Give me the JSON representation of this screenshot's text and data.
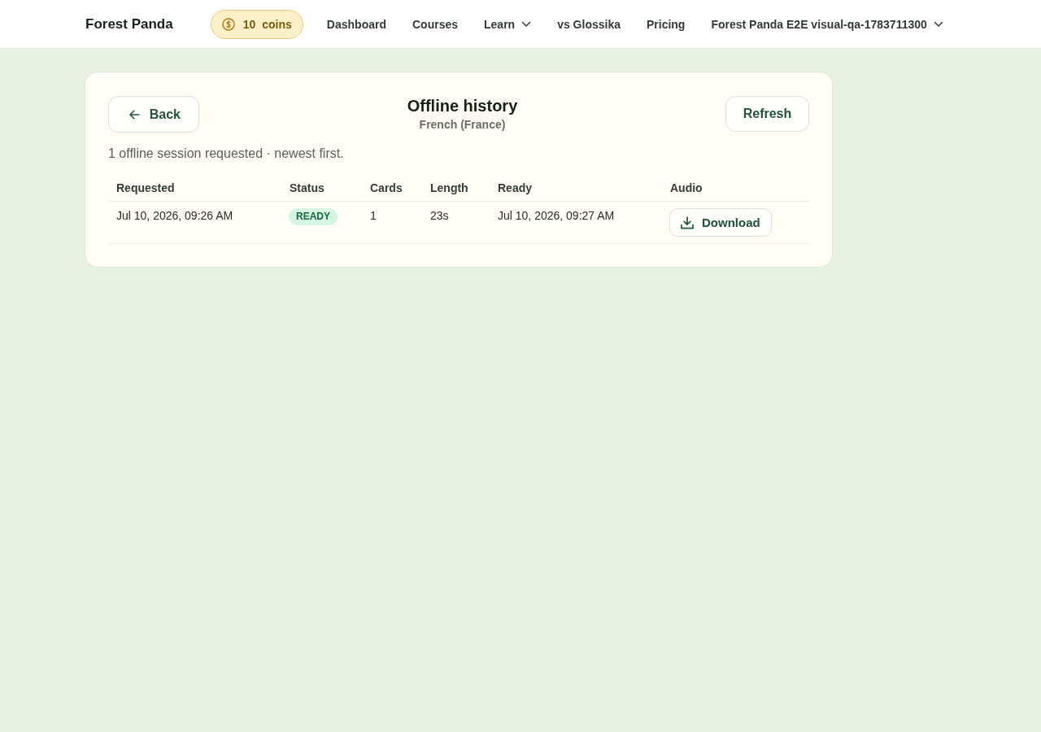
{
  "nav": {
    "brand": "Forest Panda",
    "coins": {
      "amount": "10",
      "label": "coins"
    },
    "links": [
      {
        "label": "Dashboard",
        "has_menu": false
      },
      {
        "label": "Courses",
        "has_menu": false
      },
      {
        "label": "Learn",
        "has_menu": true
      },
      {
        "label": "vs Glossika",
        "has_menu": false
      },
      {
        "label": "Pricing",
        "has_menu": false
      }
    ],
    "account": {
      "label": "Forest Panda E2E visual-qa-1783711300",
      "has_menu": true
    }
  },
  "page": {
    "back_button": "Back",
    "title": "Offline history",
    "subtitle": "French (France)",
    "refresh_button": "Refresh",
    "summary": "1 offline session requested · newest first."
  },
  "table": {
    "columns": [
      "Requested",
      "Status",
      "Cards",
      "Length",
      "Ready",
      "Audio"
    ],
    "rows": [
      {
        "requested": "Jul 10, 2026, 09:26 AM",
        "status": {
          "label": "READY",
          "kind": "ready"
        },
        "cards": "1",
        "length": "23s",
        "ready": "Jul 10, 2026, 09:27 AM",
        "audio": {
          "label": "Download"
        }
      }
    ]
  }
}
